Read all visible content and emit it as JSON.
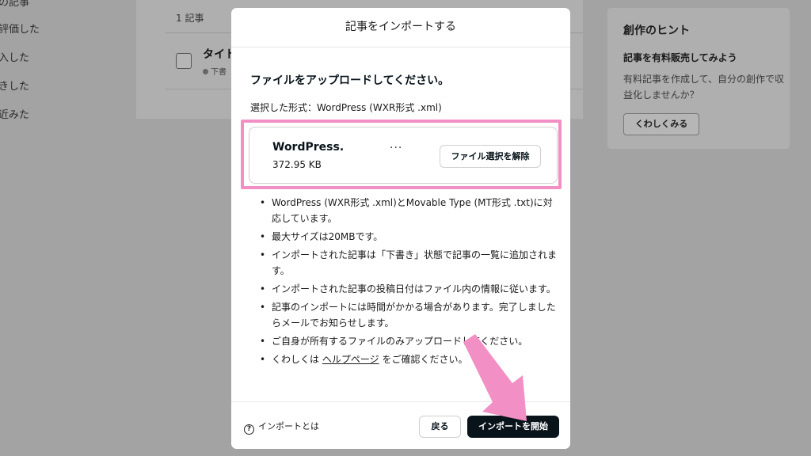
{
  "background": {
    "sidebar": [
      "の記事",
      "評価した",
      "入した",
      "きした",
      "近みた"
    ],
    "article_count": "1 記事",
    "article_title": "タイト",
    "article_status": "下書",
    "hint": {
      "title": "創作のヒント",
      "subtitle": "記事を有料販売してみよう",
      "description": "有料記事を作成して、自分の創作で収益化しませんか？",
      "button": "くわしくみる"
    }
  },
  "modal": {
    "title": "記事をインポートする",
    "upload_heading": "ファイルをアップロードしてください。",
    "selected_format": "選択した形式：WordPress (WXR形式 .xml)",
    "file": {
      "name": "WordPress.",
      "size": "372.95 KB",
      "more": "...",
      "deselect_label": "ファイル選択を解除"
    },
    "notes": [
      "WordPress (WXR形式 .xml)とMovable Type (MT形式 .txt)に対応しています。",
      "最大サイズは20MBです。",
      "インポートされた記事は「下書き」状態で記事の一覧に追加されます。",
      "インポートされた記事の投稿日付はファイル内の情報に従います。",
      "記事のインポートには時間がかかる場合があります。完了しましたらメールでお知らせします。",
      "ご自身が所有するファイルのみアップロードしてください。"
    ],
    "help_note": {
      "prefix": "くわしくは",
      "link": "ヘルプページ",
      "suffix": "をご確認ください。"
    },
    "footer": {
      "about_icon": "?",
      "about_label": "インポートとは",
      "back_label": "戻る",
      "start_label": "インポートを開始"
    }
  },
  "colors": {
    "annotation_pink": "#f28fc4",
    "primary_button": "#08131a",
    "backdrop": "#a3a3a3"
  },
  "icons": {
    "about": "question-circle-icon",
    "annotation": "pointer-arrow-icon"
  }
}
